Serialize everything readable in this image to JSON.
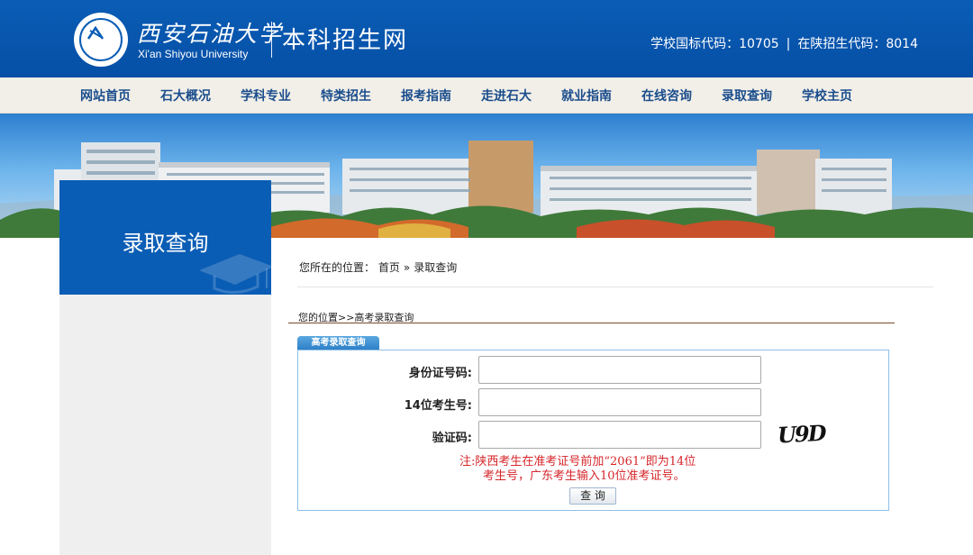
{
  "header": {
    "logo_cn": "西安石油大学",
    "logo_en": "Xi'an Shiyou University",
    "site_title": "本科招生网",
    "national_code": "学校国标代码：10705",
    "separator": "|",
    "shaanxi_code": "在陕招生代码：8014"
  },
  "nav": {
    "items": [
      {
        "label": "网站首页"
      },
      {
        "label": "石大概况"
      },
      {
        "label": "学科专业"
      },
      {
        "label": "特类招生"
      },
      {
        "label": "报考指南"
      },
      {
        "label": "走进石大"
      },
      {
        "label": "就业指南"
      },
      {
        "label": "在线咨询"
      },
      {
        "label": "录取查询"
      },
      {
        "label": "学校主页"
      }
    ]
  },
  "sidebar": {
    "title": "录取查询"
  },
  "breadcrumb": {
    "prefix": "您所在的位置：",
    "home": "首页",
    "separator": "»",
    "current": "录取查询"
  },
  "subpath": "您的位置>>高考录取查询",
  "form": {
    "tab_label": "高考录取查询",
    "id_label": "身份证号码:",
    "id_value": "",
    "exam_label": "14位考生号:",
    "exam_value": "",
    "captcha_label": "验证码:",
    "captcha_value": "",
    "captcha_text": "U9D",
    "note_line1": "注:陕西考生在准考证号前加“2061”即为14位",
    "note_line2": "考生号，广东考生输入10位准考证号。",
    "submit_label": "查 询"
  },
  "colors": {
    "header_blue": "#0a5db5",
    "nav_text": "#1a4d8c",
    "note_red": "#d6262b",
    "form_border": "#8fbfe8"
  }
}
